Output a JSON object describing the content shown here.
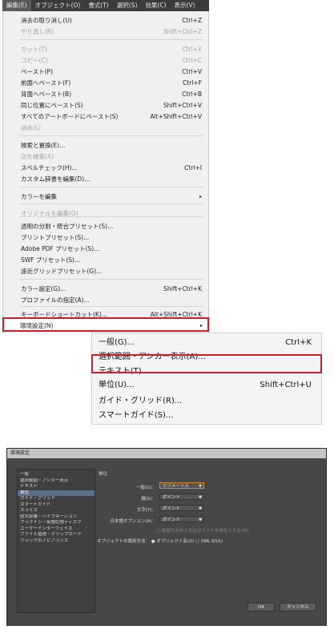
{
  "menubar": {
    "items": [
      {
        "label": "編集(E)",
        "active": true
      },
      {
        "label": "オブジェクト(O)"
      },
      {
        "label": "書式(T)"
      },
      {
        "label": "選択(S)"
      },
      {
        "label": "効果(C)"
      },
      {
        "label": "表示(V)"
      }
    ]
  },
  "edit_menu": {
    "items": [
      {
        "label": "消去の取り消し(U)",
        "shortcut": "Ctrl+Z"
      },
      {
        "label": "やり直し(R)",
        "shortcut": "Shift+Ctrl+Z",
        "disabled": true
      },
      {
        "label": "カット(T)",
        "shortcut": "Ctrl+X",
        "disabled": true
      },
      {
        "label": "コピー(C)",
        "shortcut": "Ctrl+C",
        "disabled": true
      },
      {
        "label": "ペースト(P)",
        "shortcut": "Ctrl+V"
      },
      {
        "label": "前面へペースト(F)",
        "shortcut": "Ctrl+F"
      },
      {
        "label": "背面へペースト(B)",
        "shortcut": "Ctrl+B"
      },
      {
        "label": "同じ位置にペースト(S)",
        "shortcut": "Shift+Ctrl+V"
      },
      {
        "label": "すべてのアートボードにペースト(S)",
        "shortcut": "Alt+Shift+Ctrl+V"
      },
      {
        "label": "消去(L)",
        "shortcut": "",
        "disabled": true
      },
      {
        "label": "検索と置換(E)...",
        "shortcut": ""
      },
      {
        "label": "次を検索(X)",
        "shortcut": "",
        "disabled": true
      },
      {
        "label": "スペルチェック(H)...",
        "shortcut": "Ctrl+I"
      },
      {
        "label": "カスタム辞書を編集(D)...",
        "shortcut": ""
      },
      {
        "label": "カラーを編集",
        "shortcut": "▸"
      },
      {
        "label": "オリジナルを編集(O)",
        "shortcut": "",
        "disabled": true
      },
      {
        "label": "透明の分割・統合プリセット(S)...",
        "shortcut": ""
      },
      {
        "label": "プリントプリセット(S)...",
        "shortcut": ""
      },
      {
        "label": "Adobe PDF プリセット(S)...",
        "shortcut": ""
      },
      {
        "label": "SWF プリセット(S)...",
        "shortcut": ""
      },
      {
        "label": "遠近グリッドプリセット(G)...",
        "shortcut": ""
      },
      {
        "label": "カラー設定(G)...",
        "shortcut": "Shift+Ctrl+K"
      },
      {
        "label": "プロファイルの指定(A)...",
        "shortcut": ""
      },
      {
        "label": "キーボードショートカット(K)...",
        "shortcut": "Alt+Shift+Ctrl+K"
      },
      {
        "label": "環境設定(N)",
        "shortcut": "▸"
      }
    ]
  },
  "submenu": {
    "items": [
      {
        "label": "一般(G)...",
        "shortcut": "Ctrl+K"
      },
      {
        "label": "選択範囲・アンカー表示(A)...",
        "shortcut": ""
      },
      {
        "label": "テキスト(T)...",
        "shortcut": ""
      },
      {
        "label": "単位(U)...",
        "shortcut": "Shift+Ctrl+U"
      },
      {
        "label": "ガイド・グリッド(R)...",
        "shortcut": ""
      },
      {
        "label": "スマートガイド(S)...",
        "shortcut": ""
      }
    ]
  },
  "dialog": {
    "title": "環境設定",
    "categories": [
      "一般",
      "選択範囲・アンカー表示",
      "テキスト",
      "単位",
      "ガイド・グリッド",
      "スマートガイド",
      "スライス",
      "欧文辞書・ハイフネーション",
      "プラグイン・仮想記憶ディスク",
      "ユーザーインターフェイス",
      "ファイル管理・クリップボード",
      "ブラックのアピアランス"
    ],
    "selected_category": "単位",
    "section_title": "単位",
    "general_label": "一般(G)：",
    "general_value": "ミリメートル",
    "stroke_label": "線(S)：",
    "stroke_value": "ポイント",
    "type_label": "文字(Y)：",
    "type_value": "ポイント",
    "asian_label": "日本語オプション(A)：",
    "asian_value": "ポイント",
    "checkbox_label": "数値のみの入力はポイントを単位とする(W)",
    "identify_label": "オブジェクトの識別方法：",
    "identify_opt1": "オブジェクト名(O)",
    "identify_opt2": "XML ID(X)",
    "ok_label": "OK",
    "cancel_label": "キャンセル",
    "accent_color": "#d7882f"
  }
}
